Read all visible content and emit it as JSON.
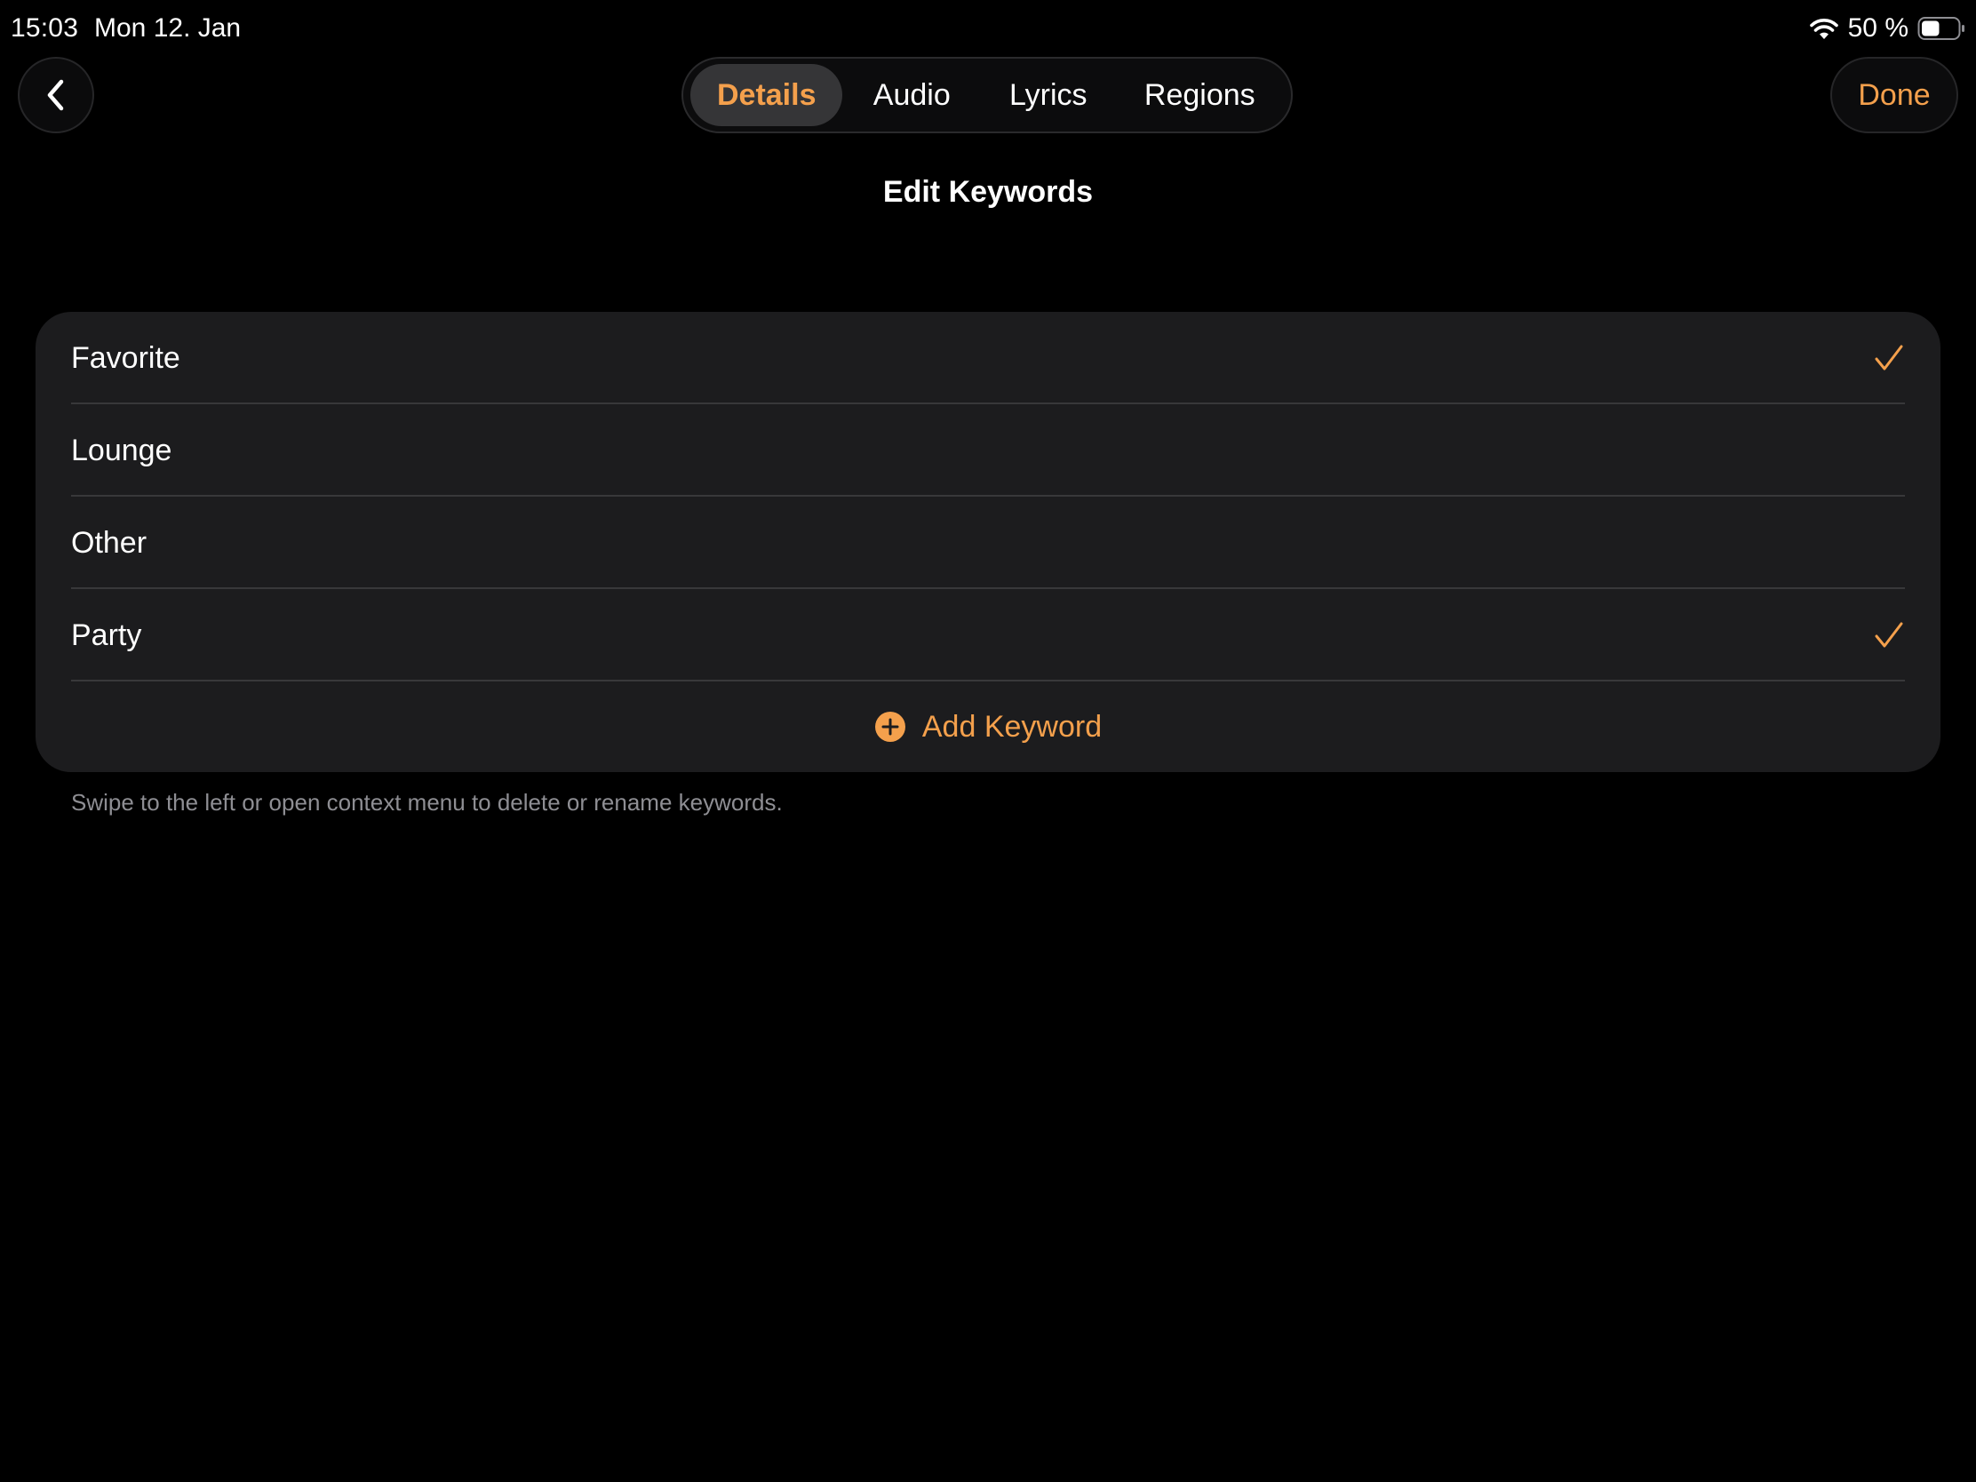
{
  "status_bar": {
    "time": "15:03",
    "date": "Mon 12. Jan",
    "battery_percent": "50 %",
    "battery_level": 0.5,
    "icons": [
      "wifi-icon",
      "battery-icon"
    ]
  },
  "nav": {
    "back_icon": "chevron-left-icon",
    "tabs": [
      {
        "label": "Details",
        "selected": true
      },
      {
        "label": "Audio",
        "selected": false
      },
      {
        "label": "Lyrics",
        "selected": false
      },
      {
        "label": "Regions",
        "selected": false
      }
    ],
    "done_label": "Done"
  },
  "page": {
    "title": "Edit Keywords"
  },
  "keywords": [
    {
      "label": "Favorite",
      "checked": true
    },
    {
      "label": "Lounge",
      "checked": false
    },
    {
      "label": "Other",
      "checked": false
    },
    {
      "label": "Party",
      "checked": true
    }
  ],
  "add_keyword": {
    "label": "Add Keyword",
    "icon": "plus-circle-icon"
  },
  "footer": {
    "hint": "Swipe to the left or open context menu to delete or rename keywords."
  },
  "colors": {
    "accent": "#f4a04c",
    "background": "#000000",
    "card": "#1c1c1e",
    "separator": "#38383a",
    "secondary_text": "#8e8e93"
  }
}
